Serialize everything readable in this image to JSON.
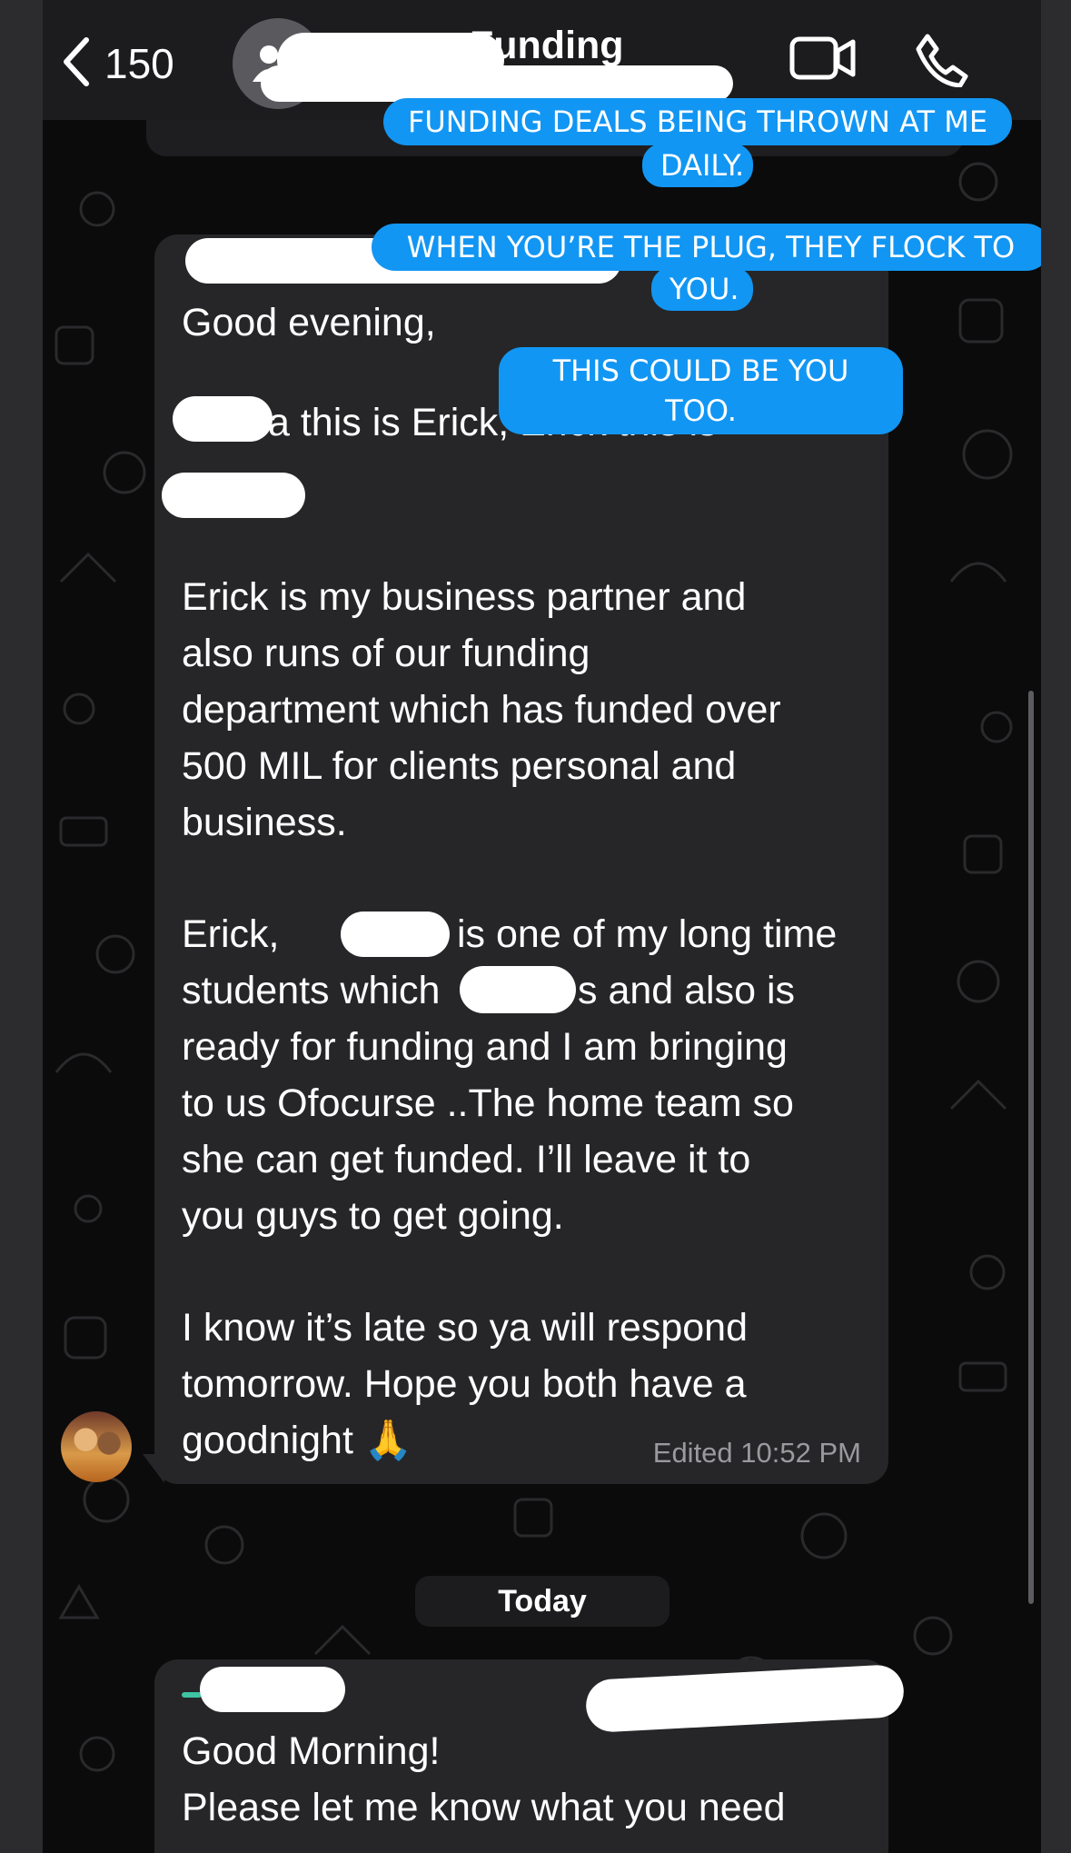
{
  "header": {
    "back_count": "150",
    "title": "Funding",
    "icons": [
      "chevron-left-icon",
      "group-avatar-icon",
      "video-call-icon",
      "phone-icon"
    ]
  },
  "captions": {
    "line1": "FUNDING DEALS BEING THROWN AT ME",
    "line1_tail": "DAILY.",
    "line2": "WHEN YOU’RE THE PLUG, THEY FLOCK TO",
    "line2_tail": "YOU.",
    "line3": "THIS COULD BE YOU TOO."
  },
  "message1": {
    "greeting": "Good evening,",
    "intro": "a this is Erick, Erick this is",
    "para1": [
      "Erick is my business partner and",
      "also runs of our funding",
      "department which has funded over",
      "500 MIL for clients personal and",
      "business."
    ],
    "para2_l1_a": "Erick, ",
    "para2_l1_b": "is one of my long time",
    "para2_l2_a": "students which ",
    "para2_l2_b": "s and also is",
    "para2_rest": [
      "ready for funding and I am bringing",
      "to us Ofocurse ..The home team so",
      "she can get funded. I’ll leave it to",
      "you guys to get going."
    ],
    "para3": [
      "I know it’s late so ya will respond",
      "tomorrow. Hope you both have a",
      "goodnight 🙏"
    ],
    "edited": "Edited",
    "time": "10:52 PM"
  },
  "date_separator": "Today",
  "message2": {
    "line1": "Good Morning!",
    "line2": "Please let me know what you need"
  },
  "colors": {
    "caption_blue": "#1296f3",
    "bubble": "#262628",
    "header": "#1c1c1e",
    "background": "#0b0b0c"
  }
}
